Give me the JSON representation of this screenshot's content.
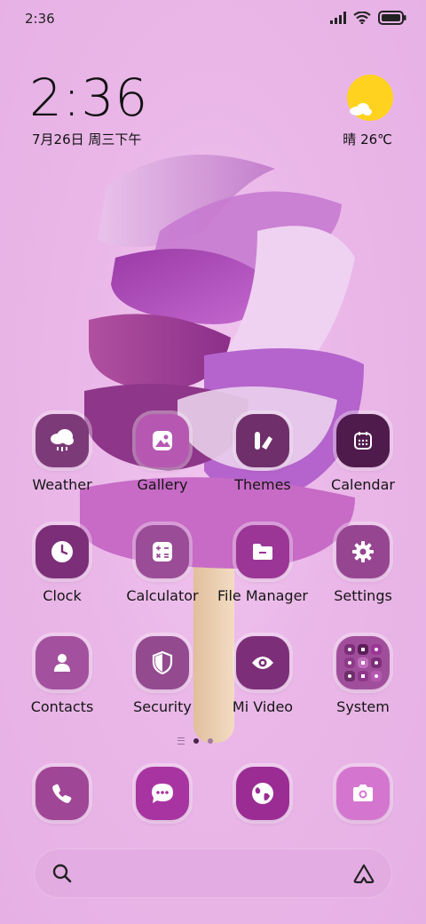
{
  "status_bar": {
    "time": "2:36"
  },
  "clock_widget": {
    "time": "2:36",
    "date": "7月26日 周三下午"
  },
  "weather_widget": {
    "text": "晴 26℃",
    "icon": "sunny-cloud-icon"
  },
  "apps": [
    {
      "label": "Weather",
      "icon": "cloud-icon",
      "color": "#7c3a78"
    },
    {
      "label": "Gallery",
      "icon": "image-icon",
      "color": "#b658b2"
    },
    {
      "label": "Themes",
      "icon": "themes-icon",
      "color": "#6e2f6a"
    },
    {
      "label": "Calendar",
      "icon": "calendar-icon",
      "color": "#4f1a4c"
    },
    {
      "label": "Clock",
      "icon": "clock-icon",
      "color": "#7c2e78"
    },
    {
      "label": "Calculator",
      "icon": "calculator-icon",
      "color": "#9a4c97"
    },
    {
      "label": "File Manager",
      "icon": "folder-icon",
      "color": "#9b3696"
    },
    {
      "label": "Settings",
      "icon": "gear-icon",
      "color": "#964590"
    },
    {
      "label": "Contacts",
      "icon": "person-icon",
      "color": "#a3509e"
    },
    {
      "label": "Security",
      "icon": "shield-icon",
      "color": "#934a8f"
    },
    {
      "label": "Mi Video",
      "icon": "eye-icon",
      "color": "#7c2f78"
    },
    {
      "label": "System",
      "icon": "folder-grid-icon",
      "color": "#a04e9b"
    }
  ],
  "dock": [
    {
      "icon": "phone-icon",
      "color": "#a04696"
    },
    {
      "icon": "message-icon",
      "color": "#a834a1"
    },
    {
      "icon": "browser-icon",
      "color": "#9a2c94"
    },
    {
      "icon": "camera-icon",
      "color": "#d476cf"
    }
  ],
  "page_indicator": {
    "pages": 2,
    "current": 1
  }
}
